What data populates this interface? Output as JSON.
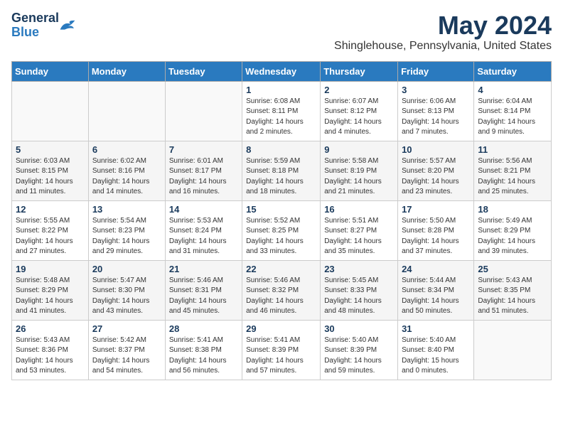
{
  "header": {
    "logo_general": "General",
    "logo_blue": "Blue",
    "month": "May 2024",
    "location": "Shinglehouse, Pennsylvania, United States"
  },
  "weekdays": [
    "Sunday",
    "Monday",
    "Tuesday",
    "Wednesday",
    "Thursday",
    "Friday",
    "Saturday"
  ],
  "weeks": [
    [
      {
        "day": "",
        "info": ""
      },
      {
        "day": "",
        "info": ""
      },
      {
        "day": "",
        "info": ""
      },
      {
        "day": "1",
        "info": "Sunrise: 6:08 AM\nSunset: 8:11 PM\nDaylight: 14 hours\nand 2 minutes."
      },
      {
        "day": "2",
        "info": "Sunrise: 6:07 AM\nSunset: 8:12 PM\nDaylight: 14 hours\nand 4 minutes."
      },
      {
        "day": "3",
        "info": "Sunrise: 6:06 AM\nSunset: 8:13 PM\nDaylight: 14 hours\nand 7 minutes."
      },
      {
        "day": "4",
        "info": "Sunrise: 6:04 AM\nSunset: 8:14 PM\nDaylight: 14 hours\nand 9 minutes."
      }
    ],
    [
      {
        "day": "5",
        "info": "Sunrise: 6:03 AM\nSunset: 8:15 PM\nDaylight: 14 hours\nand 11 minutes."
      },
      {
        "day": "6",
        "info": "Sunrise: 6:02 AM\nSunset: 8:16 PM\nDaylight: 14 hours\nand 14 minutes."
      },
      {
        "day": "7",
        "info": "Sunrise: 6:01 AM\nSunset: 8:17 PM\nDaylight: 14 hours\nand 16 minutes."
      },
      {
        "day": "8",
        "info": "Sunrise: 5:59 AM\nSunset: 8:18 PM\nDaylight: 14 hours\nand 18 minutes."
      },
      {
        "day": "9",
        "info": "Sunrise: 5:58 AM\nSunset: 8:19 PM\nDaylight: 14 hours\nand 21 minutes."
      },
      {
        "day": "10",
        "info": "Sunrise: 5:57 AM\nSunset: 8:20 PM\nDaylight: 14 hours\nand 23 minutes."
      },
      {
        "day": "11",
        "info": "Sunrise: 5:56 AM\nSunset: 8:21 PM\nDaylight: 14 hours\nand 25 minutes."
      }
    ],
    [
      {
        "day": "12",
        "info": "Sunrise: 5:55 AM\nSunset: 8:22 PM\nDaylight: 14 hours\nand 27 minutes."
      },
      {
        "day": "13",
        "info": "Sunrise: 5:54 AM\nSunset: 8:23 PM\nDaylight: 14 hours\nand 29 minutes."
      },
      {
        "day": "14",
        "info": "Sunrise: 5:53 AM\nSunset: 8:24 PM\nDaylight: 14 hours\nand 31 minutes."
      },
      {
        "day": "15",
        "info": "Sunrise: 5:52 AM\nSunset: 8:25 PM\nDaylight: 14 hours\nand 33 minutes."
      },
      {
        "day": "16",
        "info": "Sunrise: 5:51 AM\nSunset: 8:27 PM\nDaylight: 14 hours\nand 35 minutes."
      },
      {
        "day": "17",
        "info": "Sunrise: 5:50 AM\nSunset: 8:28 PM\nDaylight: 14 hours\nand 37 minutes."
      },
      {
        "day": "18",
        "info": "Sunrise: 5:49 AM\nSunset: 8:29 PM\nDaylight: 14 hours\nand 39 minutes."
      }
    ],
    [
      {
        "day": "19",
        "info": "Sunrise: 5:48 AM\nSunset: 8:29 PM\nDaylight: 14 hours\nand 41 minutes."
      },
      {
        "day": "20",
        "info": "Sunrise: 5:47 AM\nSunset: 8:30 PM\nDaylight: 14 hours\nand 43 minutes."
      },
      {
        "day": "21",
        "info": "Sunrise: 5:46 AM\nSunset: 8:31 PM\nDaylight: 14 hours\nand 45 minutes."
      },
      {
        "day": "22",
        "info": "Sunrise: 5:46 AM\nSunset: 8:32 PM\nDaylight: 14 hours\nand 46 minutes."
      },
      {
        "day": "23",
        "info": "Sunrise: 5:45 AM\nSunset: 8:33 PM\nDaylight: 14 hours\nand 48 minutes."
      },
      {
        "day": "24",
        "info": "Sunrise: 5:44 AM\nSunset: 8:34 PM\nDaylight: 14 hours\nand 50 minutes."
      },
      {
        "day": "25",
        "info": "Sunrise: 5:43 AM\nSunset: 8:35 PM\nDaylight: 14 hours\nand 51 minutes."
      }
    ],
    [
      {
        "day": "26",
        "info": "Sunrise: 5:43 AM\nSunset: 8:36 PM\nDaylight: 14 hours\nand 53 minutes."
      },
      {
        "day": "27",
        "info": "Sunrise: 5:42 AM\nSunset: 8:37 PM\nDaylight: 14 hours\nand 54 minutes."
      },
      {
        "day": "28",
        "info": "Sunrise: 5:41 AM\nSunset: 8:38 PM\nDaylight: 14 hours\nand 56 minutes."
      },
      {
        "day": "29",
        "info": "Sunrise: 5:41 AM\nSunset: 8:39 PM\nDaylight: 14 hours\nand 57 minutes."
      },
      {
        "day": "30",
        "info": "Sunrise: 5:40 AM\nSunset: 8:39 PM\nDaylight: 14 hours\nand 59 minutes."
      },
      {
        "day": "31",
        "info": "Sunrise: 5:40 AM\nSunset: 8:40 PM\nDaylight: 15 hours\nand 0 minutes."
      },
      {
        "day": "",
        "info": ""
      }
    ]
  ]
}
